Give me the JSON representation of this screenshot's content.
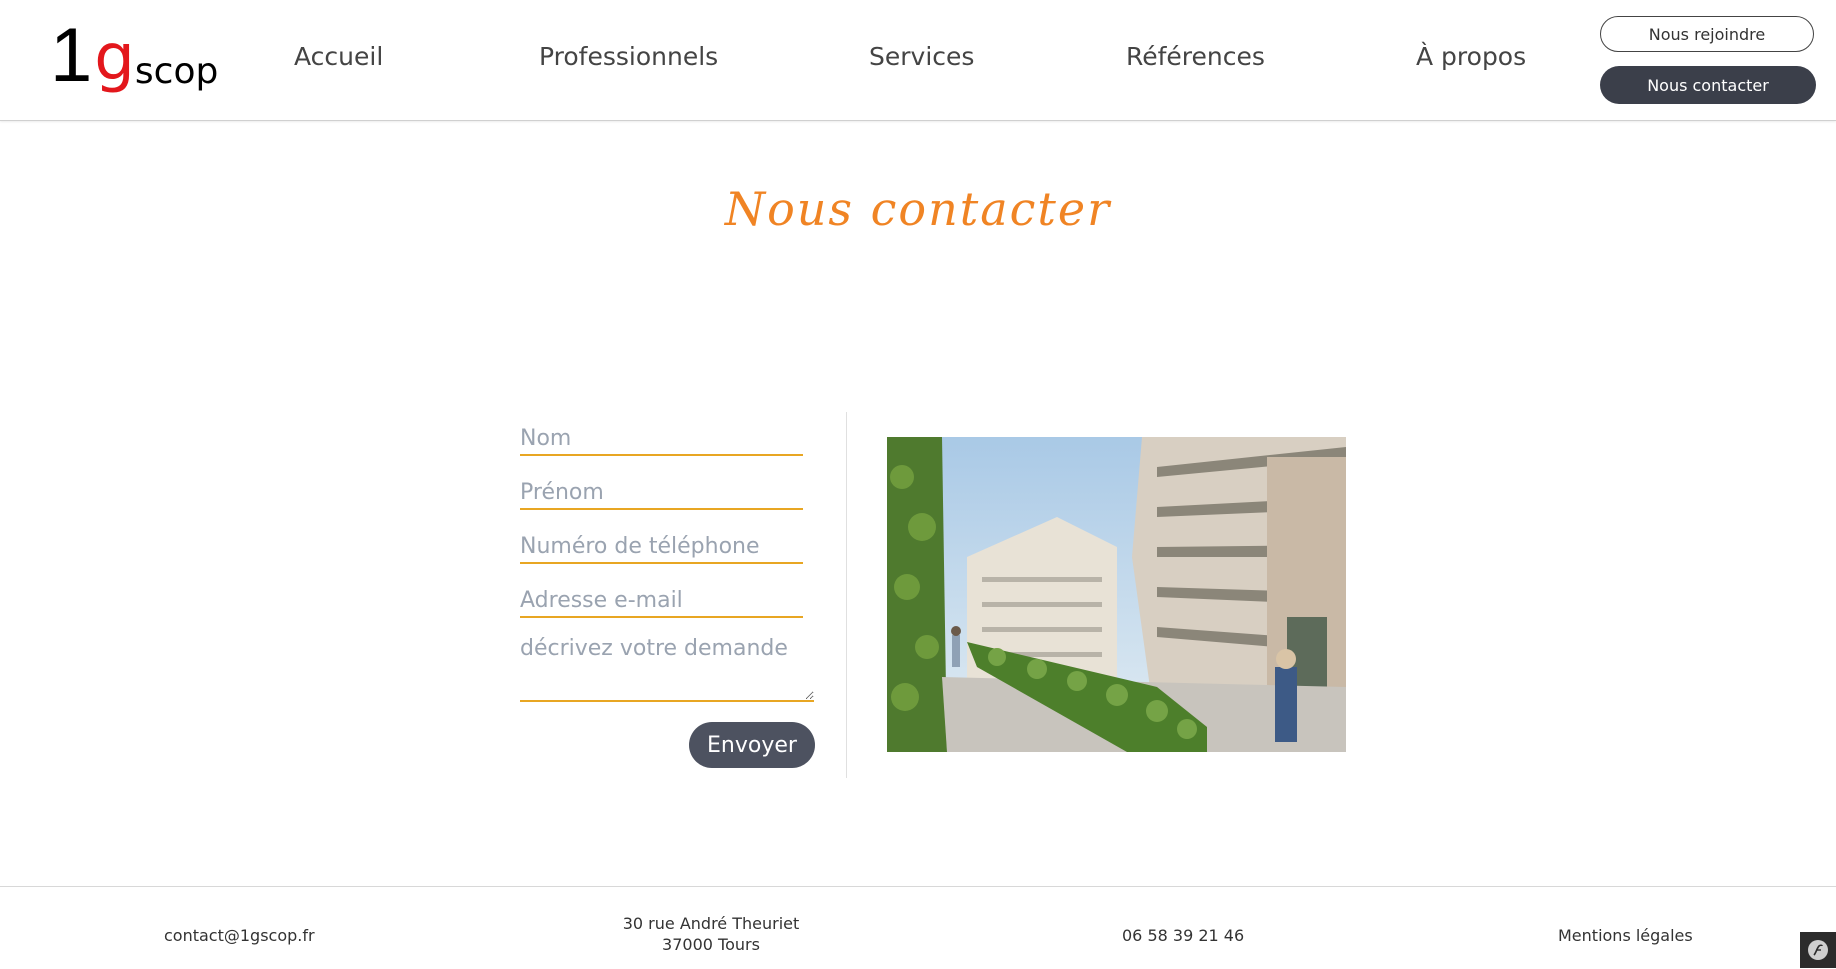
{
  "header": {
    "logo": {
      "part1": "1",
      "part2": "g",
      "part3": "scop"
    },
    "nav": [
      "Accueil",
      "Professionnels",
      "Services",
      "Références",
      "À propos"
    ],
    "join_label": "Nous rejoindre",
    "contact_label": "Nous contacter"
  },
  "page": {
    "title": "Nous contacter"
  },
  "form": {
    "last_name_placeholder": "Nom",
    "first_name_placeholder": "Prénom",
    "phone_placeholder": "Numéro de téléphone",
    "email_placeholder": "Adresse e-mail",
    "message_placeholder": "décrivez votre demande",
    "submit_label": "Envoyer"
  },
  "footer": {
    "email": "contact@1gscop.fr",
    "address_line1": "30 rue André Theuriet",
    "address_line2": "37000 Tours",
    "phone": "06 58 39 21 46",
    "legal": "Mentions légales"
  },
  "colors": {
    "accent": "#f08424",
    "underline": "#e8a623",
    "dark_button": "#3b3f4a",
    "logo_red": "#e3171c"
  }
}
